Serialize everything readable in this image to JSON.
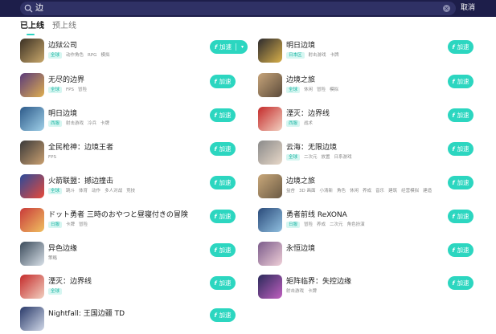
{
  "search": {
    "value": "边",
    "clear_glyph": "×",
    "cancel_label": "取消"
  },
  "tabs": [
    {
      "label": "已上线",
      "active": true
    },
    {
      "label": "预上线",
      "active": false
    }
  ],
  "button_label": "加速",
  "button_icon": "f",
  "accent_color": "#2cd6c0",
  "items": [
    {
      "name": "边狱公司",
      "tags": [
        [
          "全球",
          true
        ],
        [
          "动作角色",
          false
        ],
        [
          "RPG",
          false
        ],
        [
          "模拟",
          false
        ]
      ],
      "split": true,
      "thumb": [
        "#3a3024",
        "#c9a86b"
      ]
    },
    {
      "name": "明日边境",
      "tags": [
        [
          "日本区",
          true
        ],
        [
          "射击游戏",
          false
        ],
        [
          "卡牌",
          false
        ]
      ],
      "split": false,
      "thumb": [
        "#2c2a2e",
        "#d8b04a"
      ]
    },
    {
      "name": "无尽的边界",
      "tags": [
        [
          "全球",
          true
        ],
        [
          "FPS",
          false
        ],
        [
          "冒险",
          false
        ]
      ],
      "split": false,
      "thumb": [
        "#5a3a7a",
        "#e0b050"
      ]
    },
    {
      "name": "边境之旅",
      "tags": [
        [
          "全球",
          true
        ],
        [
          "休闲",
          false
        ],
        [
          "冒险",
          false
        ],
        [
          "模拟",
          false
        ]
      ],
      "split": false,
      "thumb": [
        "#c7a57a",
        "#5b4a3a"
      ]
    },
    {
      "name": "明日边境",
      "tags": [
        [
          "西服",
          true
        ],
        [
          "射击游戏",
          false
        ],
        [
          "冷兵",
          false
        ],
        [
          "卡牌",
          false
        ]
      ],
      "split": false,
      "thumb": [
        "#2d5a8a",
        "#9fd0e8"
      ]
    },
    {
      "name": "湮灭：边界线",
      "tags": [
        [
          "西服",
          true
        ],
        [
          "战术",
          false
        ]
      ],
      "split": false,
      "thumb": [
        "#c42a2a",
        "#f2d0c0"
      ]
    },
    {
      "name": "全民枪神：边境王者",
      "tags": [
        [
          "FPS",
          false
        ]
      ],
      "split": false,
      "thumb": [
        "#3a3a3a",
        "#caa070"
      ]
    },
    {
      "name": "云海：无限边境",
      "tags": [
        [
          "全球",
          true
        ],
        [
          "二次元",
          false
        ],
        [
          "放置",
          false
        ],
        [
          "日系游戏",
          false
        ]
      ],
      "split": false,
      "thumb": [
        "#8a8a8a",
        "#e8d8c8"
      ]
    },
    {
      "name": "火箭联盟：撼边撞击",
      "tags": [
        [
          "全球",
          true
        ],
        [
          "跳斗",
          false
        ],
        [
          "体育",
          false
        ],
        [
          "动作",
          false
        ],
        [
          "多人对战",
          false
        ],
        [
          "竞技",
          false
        ]
      ],
      "split": false,
      "thumb": [
        "#2a4a9a",
        "#e84a3a"
      ]
    },
    {
      "name": "边境之旅",
      "tags": [
        [
          "益杏",
          false
        ],
        [
          "3D 画面",
          false
        ],
        [
          "小清新",
          false
        ],
        [
          "角色",
          false
        ],
        [
          "休闲",
          false
        ],
        [
          "养成",
          false
        ],
        [
          "音乐",
          false
        ],
        [
          "建筑",
          false
        ],
        [
          "经营模拟",
          false
        ],
        [
          "建造",
          false
        ]
      ],
      "split": false,
      "thumb": [
        "#c9a87a",
        "#6b5a44"
      ]
    },
    {
      "name": "ドット勇者 三時のおやつと昼寝付きの冒険",
      "tags": [
        [
          "日服",
          true
        ],
        [
          "卡牌",
          false
        ],
        [
          "冒险",
          false
        ]
      ],
      "split": false,
      "thumb": [
        "#c83a3a",
        "#f0c060"
      ]
    },
    {
      "name": "勇者前线 ReXONA",
      "tags": [
        [
          "日服",
          true
        ],
        [
          "冒险",
          false
        ],
        [
          "养成",
          false
        ],
        [
          "二次元",
          false
        ],
        [
          "角色扮演",
          false
        ]
      ],
      "split": false,
      "thumb": [
        "#2a4a7a",
        "#90c0e0"
      ]
    },
    {
      "name": "异色边缘",
      "tags": [
        [
          "策略",
          false
        ]
      ],
      "split": false,
      "thumb": [
        "#3a4a5a",
        "#d8e0e8"
      ]
    },
    {
      "name": "永恒边境",
      "tags": [],
      "split": false,
      "thumb": [
        "#7a5a8a",
        "#f0d0d8"
      ]
    },
    {
      "name": "湮灭：边界线",
      "tags": [
        [
          "全球",
          true
        ]
      ],
      "split": false,
      "thumb": [
        "#c42a2a",
        "#f2d0c0"
      ]
    },
    {
      "name": "矩阵临界：失控边缘",
      "tags": [
        [
          "射击游戏",
          false
        ],
        [
          "卡牌",
          false
        ]
      ],
      "split": false,
      "thumb": [
        "#2a2a5a",
        "#c060c0"
      ]
    },
    {
      "name": "Nightfall: 王国边疆 TD",
      "tags": [],
      "split": false,
      "thumb": [
        "#2a3a6a",
        "#d0d8e8"
      ]
    }
  ]
}
